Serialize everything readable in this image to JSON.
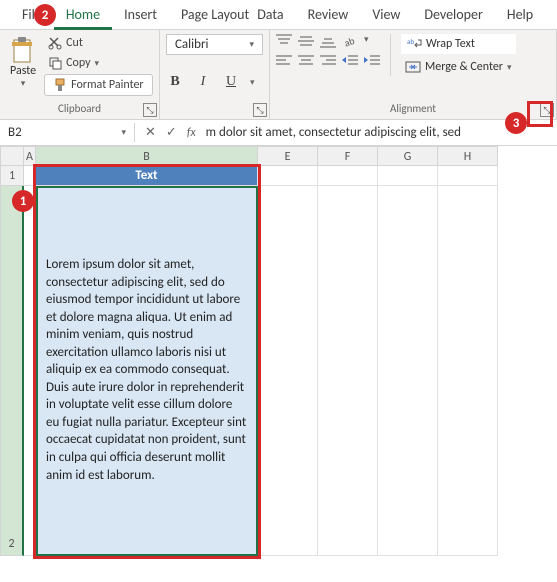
{
  "tabs": {
    "file": "File",
    "home": "Home",
    "insert": "Insert",
    "pagelayout": "Page Layout",
    "data": "Data",
    "review": "Review",
    "view": "View",
    "developer": "Developer",
    "help": "Help"
  },
  "clipboard": {
    "paste": "Paste",
    "cut": "Cut",
    "copy": "Copy",
    "format_painter": "Format Painter",
    "group": "Clipboard"
  },
  "font": {
    "name": "Calibri",
    "bold": "B",
    "italic": "I",
    "underline": "U"
  },
  "alignment": {
    "wrap": "Wrap Text",
    "merge": "Merge & Center",
    "group": "Alignment"
  },
  "namebox": "B2",
  "formula_bar": "m dolor sit amet, consectetur adipiscing elit, sed",
  "fx": "fx",
  "cols": {
    "A": "A",
    "B": "B",
    "E": "E",
    "F": "F",
    "G": "G",
    "H": "H"
  },
  "rows": {
    "r1": "1",
    "r2": "2"
  },
  "cells": {
    "B1": "Text",
    "B2": "Lorem ipsum dolor sit amet, consectetur adipiscing elit, sed do eiusmod tempor incididunt ut labore et dolore magna aliqua. Ut enim ad minim veniam, quis nostrud exercitation ullamco laboris nisi ut aliquip ex ea commodo consequat. Duis aute irure dolor in reprehenderit in voluptate velit esse cillum dolore eu fugiat nulla pariatur. Excepteur sint occaecat cupidatat non proident, sunt in culpa qui officia deserunt mollit anim id est laborum."
  },
  "callouts": {
    "c1": "1",
    "c2": "2",
    "c3": "3"
  }
}
